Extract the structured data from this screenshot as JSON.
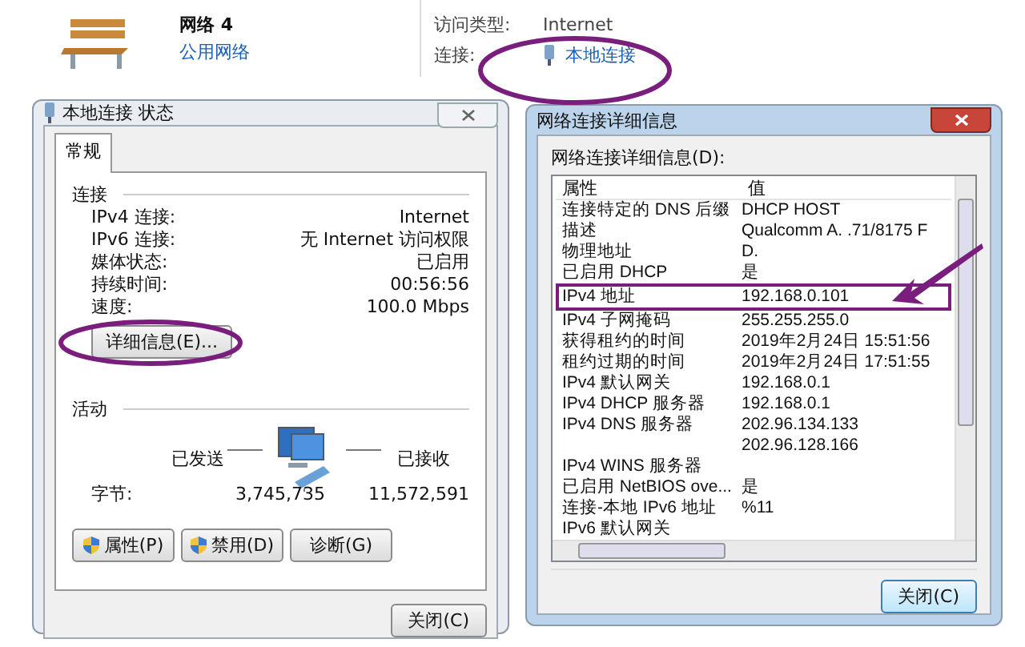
{
  "network": {
    "name": "网络 4",
    "type": "公用网络",
    "access_label": "访问类型:",
    "access_value": "Internet",
    "connection_label": "连接:",
    "connection_value": "本地连接"
  },
  "status_dialog": {
    "title": "本地连接 状态",
    "tabs": [
      {
        "label": "常规",
        "selected": true
      }
    ],
    "connection_heading": "连接",
    "connection_rows": [
      {
        "label": "IPv4 连接:",
        "value": "Internet"
      },
      {
        "label": "IPv6 连接:",
        "value": "无 Internet 访问权限"
      },
      {
        "label": "媒体状态:",
        "value": "已启用"
      },
      {
        "label": "持续时间:",
        "value": "00:56:56"
      },
      {
        "label": "速度:",
        "value": "100.0 Mbps"
      }
    ],
    "details_button": "详细信息(E)...",
    "activity_heading": "活动",
    "sent_label": "已发送",
    "received_label": "已接收",
    "bytes_label": "字节:",
    "bytes_sent": "3,745,735",
    "bytes_received": "11,572,591",
    "buttons": [
      {
        "label": "属性(P)",
        "shield": true
      },
      {
        "label": "禁用(D)",
        "shield": true
      },
      {
        "label": "诊断(G)",
        "shield": false
      }
    ],
    "close_button": "关闭(C)"
  },
  "details_dialog": {
    "title": "网络连接详细信息",
    "list_label": "网络连接详细信息(D):",
    "columns": [
      "属性",
      "值"
    ],
    "rows": [
      {
        "property": "连接特定的 DNS 后缀",
        "value": "DHCP HOST",
        "highlighted": false
      },
      {
        "property": "描述",
        "value": "Qualcomm A. .71/8175 F",
        "highlighted": false
      },
      {
        "property": "物理地址",
        "value": "D.",
        "highlighted": false
      },
      {
        "property": "已启用 DHCP",
        "value": "是",
        "highlighted": false
      },
      {
        "property": "IPv4 地址",
        "value": "192.168.0.101",
        "highlighted": true
      },
      {
        "property": "IPv4 子网掩码",
        "value": "255.255.255.0",
        "highlighted": false
      },
      {
        "property": "获得租约的时间",
        "value": "2019年2月24日 15:51:56",
        "highlighted": false
      },
      {
        "property": "租约过期的时间",
        "value": "2019年2月24日 17:51:55",
        "highlighted": false
      },
      {
        "property": "IPv4 默认网关",
        "value": "192.168.0.1",
        "highlighted": false
      },
      {
        "property": "IPv4 DHCP 服务器",
        "value": "192.168.0.1",
        "highlighted": false
      },
      {
        "property": "IPv4 DNS 服务器",
        "value": "202.96.134.133",
        "highlighted": false
      },
      {
        "property": "",
        "value": "202.96.128.166",
        "highlighted": false
      },
      {
        "property": "IPv4 WINS 服务器",
        "value": "",
        "highlighted": false
      },
      {
        "property": "已启用 NetBIOS ove...",
        "value": "是",
        "highlighted": false
      },
      {
        "property": "连接-本地 IPv6 地址",
        "value": "%11",
        "highlighted": false
      },
      {
        "property": "IPv6 默认网关",
        "value": "",
        "highlighted": false
      }
    ],
    "close_button": "关闭(C)"
  }
}
